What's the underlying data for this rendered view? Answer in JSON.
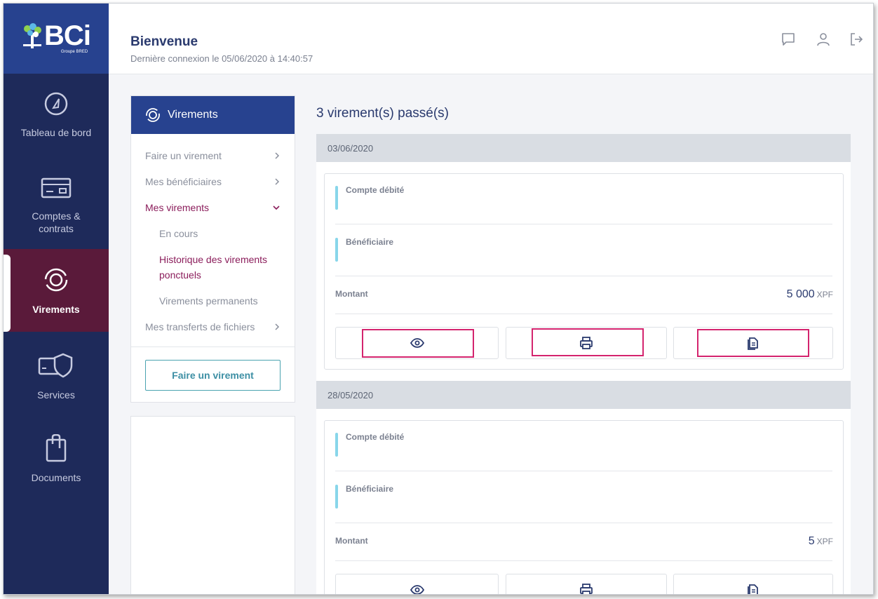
{
  "brand": {
    "logo_text": "BCi",
    "logo_sub": "Groupe BRED"
  },
  "sidebar": {
    "items": [
      {
        "label": "Tableau de bord",
        "icon": "dashboard-gauge-icon"
      },
      {
        "label": "Comptes & contrats",
        "icon": "card-icon"
      },
      {
        "label": "Virements",
        "icon": "transfer-cycle-icon",
        "active": true
      },
      {
        "label": "Services",
        "icon": "shield-card-icon"
      },
      {
        "label": "Documents",
        "icon": "clipboard-icon"
      }
    ]
  },
  "header": {
    "title": "Bienvenue",
    "last_login": "Dernière connexion le 05/06/2020 à 14:40:57",
    "icons": [
      "chat-icon",
      "user-icon",
      "logout-icon"
    ]
  },
  "submenu": {
    "title": "Virements",
    "items": [
      {
        "label": "Faire un virement"
      },
      {
        "label": "Mes bénéficiaires"
      },
      {
        "label": "Mes virements",
        "active": true
      },
      {
        "label": "Mes transferts de fichiers"
      }
    ],
    "subitems": [
      {
        "label": "En cours"
      },
      {
        "label": "Historique des virements ponctuels",
        "active": true
      },
      {
        "label": "Virements permanents"
      }
    ],
    "button_label": "Faire un virement"
  },
  "main": {
    "title": "3 virement(s) passé(s)",
    "groups": [
      {
        "date": "03/06/2020",
        "compte_label": "Compte débité",
        "beneficiaire_label": "Bénéficiaire",
        "montant_label": "Montant",
        "amount": "5 000",
        "currency": "XPF"
      },
      {
        "date": "28/05/2020",
        "compte_label": "Compte débité",
        "beneficiaire_label": "Bénéficiaire",
        "montant_label": "Montant",
        "amount": "5",
        "currency": "XPF"
      }
    ]
  },
  "colors": {
    "sidebar_bg": "#1e2a5a",
    "logo_bg": "#27428f",
    "active_nav": "#5a1a3a",
    "accent_magenta": "#8b1d5b",
    "highlight": "#d4246e"
  }
}
